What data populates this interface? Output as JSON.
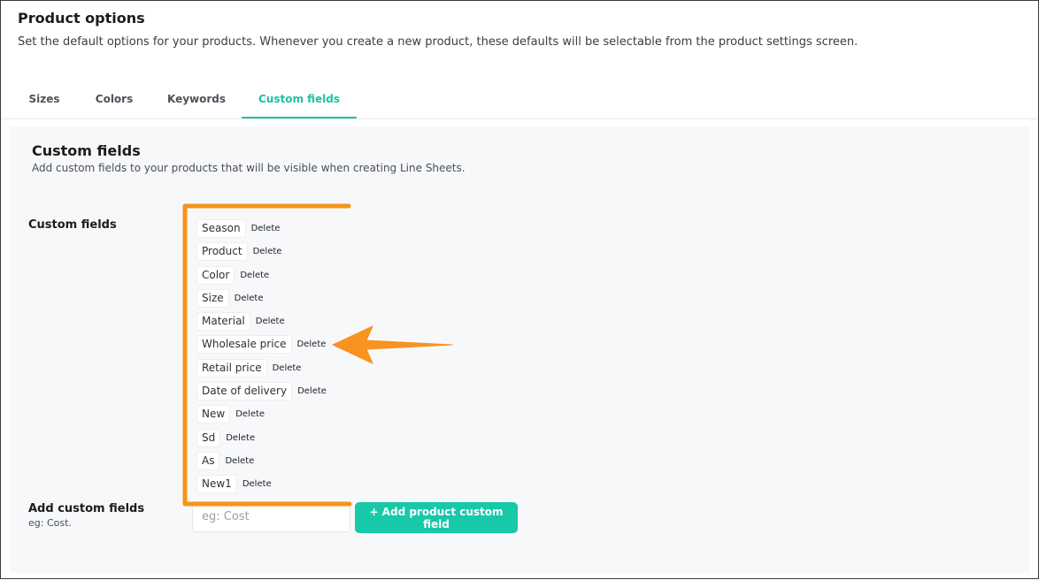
{
  "header": {
    "title": "Product options",
    "subtitle": "Set the default options for your products. Whenever you create a new product, these defaults will be selectable from the product settings screen."
  },
  "tabs": [
    {
      "label": "Sizes",
      "active": false
    },
    {
      "label": "Colors",
      "active": false
    },
    {
      "label": "Keywords",
      "active": false
    },
    {
      "label": "Custom fields",
      "active": true
    }
  ],
  "panel": {
    "title": "Custom fields",
    "subtitle": "Add custom fields to your products that will be visible when creating Line Sheets.",
    "fields_label": "Custom fields",
    "delete_label": "Delete",
    "fields": [
      "Season",
      "Product",
      "Color",
      "Size",
      "Material",
      "Wholesale price",
      "Retail price",
      "Date of delivery",
      "New",
      "Sd",
      "As",
      "New1"
    ],
    "add": {
      "label": "Add custom fields",
      "hint": "eg: Cost.",
      "placeholder": "eg: Cost",
      "button_label": "+ Add product custom field"
    }
  },
  "colors": {
    "accent": "#17c3a5",
    "annotation": "#f7931e"
  }
}
